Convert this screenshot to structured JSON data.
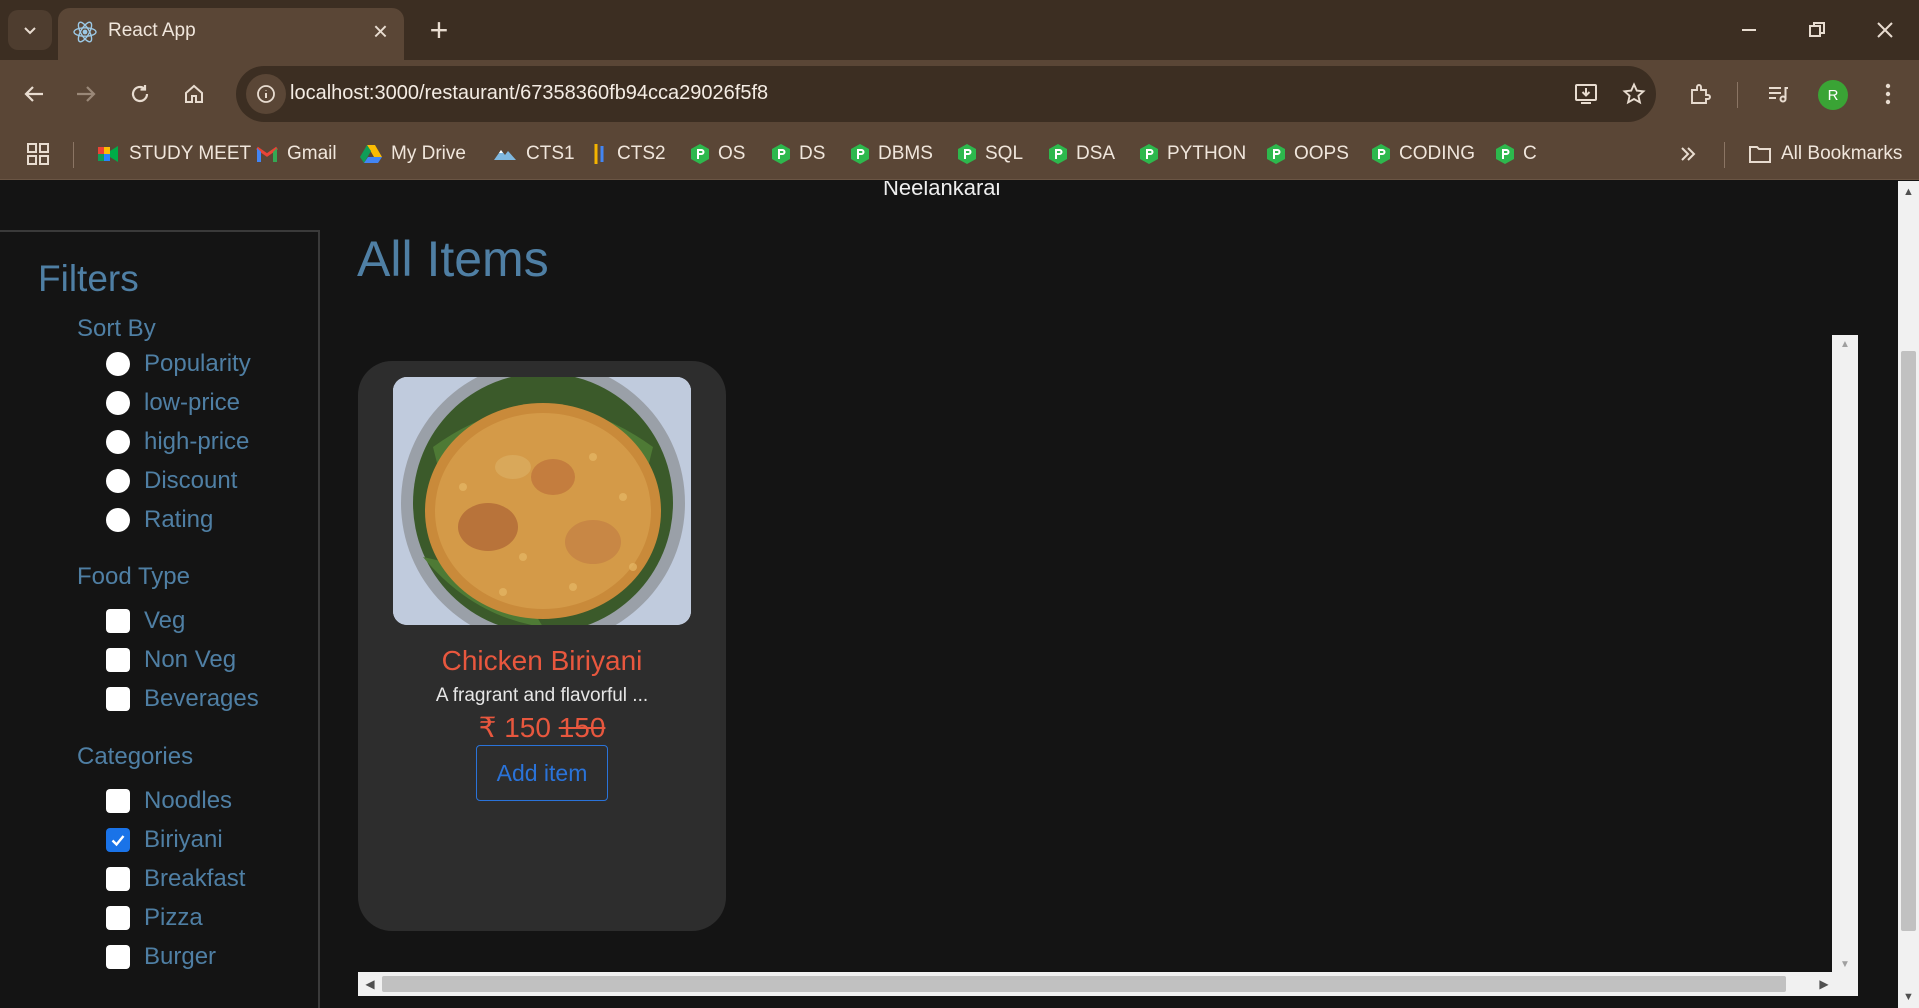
{
  "browser": {
    "tab_title": "React App",
    "url": "localhost:3000/restaurant/67358360fb94cca29026f5f8",
    "profile_initial": "R",
    "bookmarks": [
      {
        "label": "STUDY MEET",
        "icon": "meet-icon"
      },
      {
        "label": "Gmail",
        "icon": "gmail-icon"
      },
      {
        "label": "My Drive",
        "icon": "drive-icon"
      },
      {
        "label": "CTS1",
        "icon": "cts1-icon"
      },
      {
        "label": "CTS2",
        "icon": "cts2-icon"
      },
      {
        "label": "OS",
        "icon": "gem-icon"
      },
      {
        "label": "DS",
        "icon": "gem-icon"
      },
      {
        "label": "DBMS",
        "icon": "gem-icon"
      },
      {
        "label": "SQL",
        "icon": "gem-icon"
      },
      {
        "label": "DSA",
        "icon": "gem-icon"
      },
      {
        "label": "PYTHON",
        "icon": "gem-icon"
      },
      {
        "label": "OOPS",
        "icon": "gem-icon"
      },
      {
        "label": "CODING",
        "icon": "gem-icon"
      },
      {
        "label": "C",
        "icon": "gem-icon"
      }
    ],
    "all_bookmarks": "All Bookmarks"
  },
  "page": {
    "location": "Neelankarai",
    "main_title": "All Items"
  },
  "filters": {
    "title": "Filters",
    "sort_by": {
      "title": "Sort By",
      "options": [
        "Popularity",
        "low-price",
        "high-price",
        "Discount",
        "Rating"
      ]
    },
    "food_type": {
      "title": "Food Type",
      "options": [
        "Veg",
        "Non Veg",
        "Beverages"
      ]
    },
    "categories": {
      "title": "Categories",
      "options": [
        {
          "label": "Noodles",
          "checked": false
        },
        {
          "label": "Biriyani",
          "checked": true
        },
        {
          "label": "Breakfast",
          "checked": false
        },
        {
          "label": "Pizza",
          "checked": false
        },
        {
          "label": "Burger",
          "checked": false
        }
      ]
    }
  },
  "items": [
    {
      "name": "Chicken Biriyani",
      "description": "A fragrant and flavorful ...",
      "currency": "₹",
      "price": "150",
      "original_price": "150",
      "add_label": "Add item"
    }
  ],
  "colors": {
    "accent": "#4f7fa4",
    "item_name": "#e8573e",
    "button": "#2a73d9",
    "background": "#141414",
    "card": "#2d2d2d",
    "chrome": "#5a4636"
  }
}
